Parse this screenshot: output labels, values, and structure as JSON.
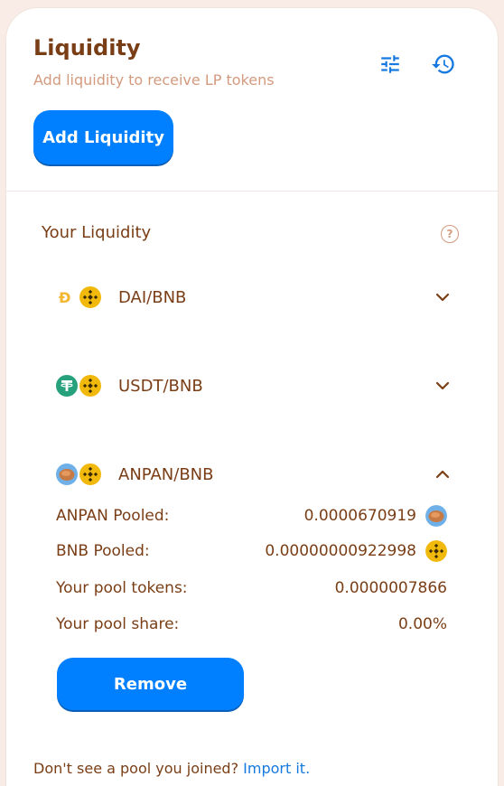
{
  "header": {
    "title": "Liquidity",
    "subtitle": "Add liquidity to receive LP tokens",
    "add_button": "Add Liquidity",
    "settings_icon": "sliders-icon",
    "history_icon": "history-icon"
  },
  "your_liquidity": {
    "heading": "Your Liquidity",
    "help_icon": "?"
  },
  "pairs": [
    {
      "label": "DAI/BNB",
      "tokens": [
        "DAI",
        "BNB"
      ],
      "expanded": false
    },
    {
      "label": "USDT/BNB",
      "tokens": [
        "USDT",
        "BNB"
      ],
      "expanded": false
    },
    {
      "label": "ANPAN/BNB",
      "tokens": [
        "ANPAN",
        "BNB"
      ],
      "expanded": true
    }
  ],
  "details": {
    "anpan_pooled_label": "ANPAN Pooled:",
    "anpan_pooled_value": "0.0000670919",
    "bnb_pooled_label": "BNB Pooled:",
    "bnb_pooled_value": "0.00000000922998",
    "pool_tokens_label": "Your pool tokens:",
    "pool_tokens_value": "0.0000007866",
    "pool_share_label": "Your pool share:",
    "pool_share_value": "0.00%"
  },
  "remove_button": "Remove",
  "footer": {
    "text": "Don't see a pool you joined?",
    "link": "Import it."
  },
  "colors": {
    "accent": "#0080ff",
    "text_brown": "#7a3e16",
    "subtitle": "#d39a7e",
    "bnb": "#f0b90b",
    "usdt": "#26a17b",
    "dai": "#f4b731"
  }
}
